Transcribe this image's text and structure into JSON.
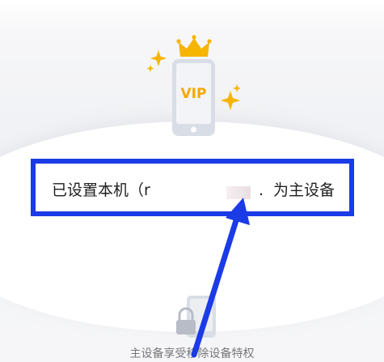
{
  "hero": {
    "badge_text": "VIP"
  },
  "device": {
    "prefix": "已设置本机（r",
    "suffix": "为主设备",
    "separator": "."
  },
  "footer": {
    "text": "主设备享受移除设备特权"
  },
  "colors": {
    "accent_blue": "#1a3be6",
    "gold": "#f6b500",
    "vip_text": "#f4a900"
  },
  "icons": {
    "hero": "phone-vip-icon",
    "crown": "crown-icon",
    "sparkles": "sparkle-icon",
    "footer": "lock-phone-icon",
    "annotation": "arrow-annotation"
  }
}
